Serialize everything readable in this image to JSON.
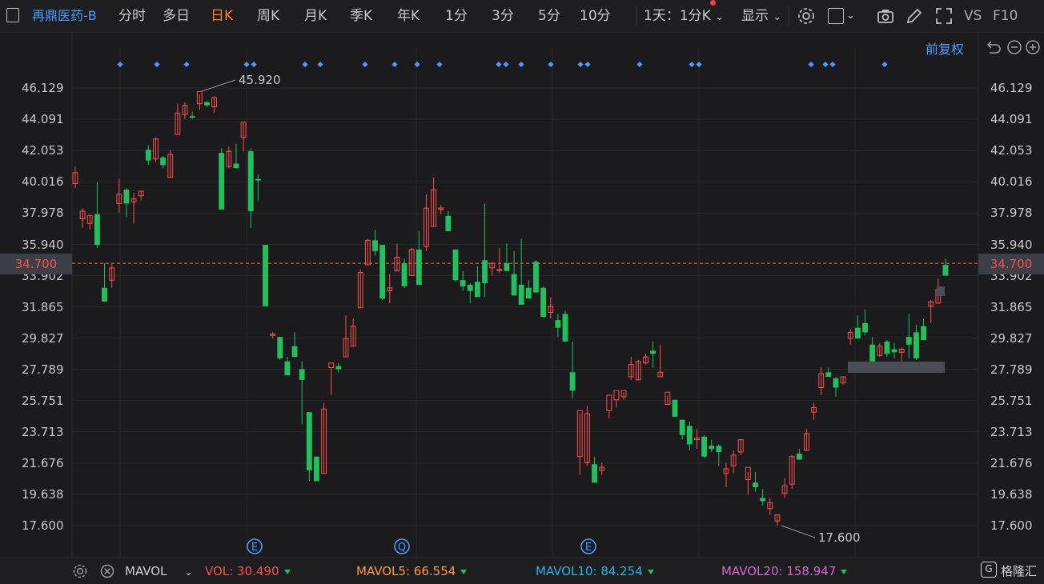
{
  "toolbar": {
    "title": "再鼎医药-B",
    "tabs": [
      "分时",
      "多日",
      "日K",
      "周K",
      "月K",
      "季K",
      "年K",
      "1分",
      "3分",
      "5分",
      "10分"
    ],
    "active_tab": "日K",
    "period_select": "1天：1分K",
    "display": "显示",
    "vs": "VS",
    "f10": "F10"
  },
  "adjust": "前复权",
  "price_axis": [
    "46.129",
    "44.091",
    "42.053",
    "40.016",
    "37.978",
    "35.940",
    "33.902",
    "31.865",
    "29.827",
    "27.789",
    "25.751",
    "23.713",
    "21.676",
    "19.638",
    "17.600"
  ],
  "current_price": "34.700",
  "chart_data": {
    "type": "candlestick",
    "ylim": [
      16.5,
      48.5
    ],
    "high_label": "45.920",
    "low_label": "17.600",
    "event_markers": [
      "E",
      "Q",
      "E"
    ],
    "candles": [
      [
        39.9,
        41.0,
        39.6,
        40.6
      ],
      [
        37.6,
        38.3,
        37.0,
        38.1
      ],
      [
        37.3,
        37.9,
        36.9,
        37.8
      ],
      [
        37.9,
        40.0,
        35.7,
        35.9
      ],
      [
        33.1,
        34.7,
        32.3,
        32.2
      ],
      [
        33.6,
        34.7,
        33.1,
        34.4
      ],
      [
        38.6,
        40.2,
        38.0,
        39.2
      ],
      [
        39.5,
        39.6,
        37.7,
        38.6
      ],
      [
        38.7,
        39.3,
        37.3,
        38.9
      ],
      [
        39.1,
        39.4,
        38.8,
        39.4
      ],
      [
        42.1,
        42.4,
        41.1,
        41.4
      ],
      [
        41.5,
        42.9,
        41.3,
        42.8
      ],
      [
        41.6,
        41.7,
        40.9,
        41.1
      ],
      [
        40.3,
        42.1,
        40.3,
        41.8
      ],
      [
        43.1,
        45.1,
        43.1,
        44.5
      ],
      [
        44.4,
        45.2,
        44.1,
        45.0
      ],
      [
        44.3,
        44.6,
        44.1,
        44.2
      ],
      [
        45.1,
        45.7,
        44.7,
        45.9
      ],
      [
        45.2,
        45.3,
        44.9,
        45.0
      ],
      [
        44.9,
        45.6,
        44.5,
        45.5
      ],
      [
        41.9,
        42.2,
        38.5,
        38.2
      ],
      [
        41.0,
        42.3,
        40.9,
        42.0
      ],
      [
        41.2,
        42.5,
        40.9,
        40.9
      ],
      [
        42.9,
        43.9,
        42.0,
        43.9
      ],
      [
        42.0,
        42.2,
        37.0,
        38.1
      ],
      [
        40.2,
        40.5,
        38.8,
        40.1
      ],
      [
        35.9,
        35.9,
        32.1,
        31.9
      ],
      [
        30.0,
        30.2,
        29.8,
        30.1
      ],
      [
        29.9,
        29.9,
        28.4,
        28.5
      ],
      [
        28.3,
        28.6,
        27.4,
        27.4
      ],
      [
        29.3,
        30.2,
        28.6,
        28.6
      ],
      [
        27.8,
        28.3,
        24.2,
        27.1
      ],
      [
        25.0,
        25.0,
        20.5,
        21.2
      ],
      [
        22.1,
        22.1,
        20.5,
        20.5
      ],
      [
        21.0,
        25.6,
        21.0,
        25.2
      ],
      [
        27.9,
        27.9,
        26.1,
        28.2
      ],
      [
        28.0,
        28.2,
        27.6,
        27.8
      ],
      [
        28.6,
        31.3,
        28.6,
        29.8
      ],
      [
        29.3,
        31.1,
        29.3,
        30.6
      ],
      [
        31.8,
        34.3,
        31.8,
        34.1
      ],
      [
        34.6,
        36.3,
        34.6,
        36.2
      ],
      [
        36.2,
        36.9,
        35.2,
        35.5
      ],
      [
        35.9,
        35.9,
        32.3,
        32.4
      ],
      [
        32.9,
        34.0,
        32.1,
        33.1
      ],
      [
        34.2,
        36.0,
        34.2,
        35.1
      ],
      [
        34.7,
        35.0,
        33.1,
        33.2
      ],
      [
        33.9,
        35.7,
        33.9,
        35.6
      ],
      [
        35.6,
        36.8,
        33.3,
        33.3
      ],
      [
        35.8,
        39.2,
        35.5,
        38.3
      ],
      [
        37.1,
        40.3,
        37.1,
        39.5
      ],
      [
        38.3,
        38.5,
        37.9,
        38.3
      ],
      [
        37.8,
        38.1,
        36.8,
        36.8
      ],
      [
        35.6,
        35.6,
        33.5,
        33.6
      ],
      [
        33.6,
        34.2,
        32.9,
        33.2
      ],
      [
        33.3,
        33.4,
        32.1,
        32.9
      ],
      [
        33.5,
        34.5,
        32.6,
        32.5
      ],
      [
        34.9,
        38.6,
        32.5,
        33.4
      ],
      [
        34.4,
        34.8,
        33.9,
        34.7
      ],
      [
        34.3,
        35.7,
        34.1,
        34.3
      ],
      [
        34.7,
        36.0,
        34.3,
        34.2
      ],
      [
        34.0,
        35.5,
        34.0,
        32.6
      ],
      [
        33.3,
        36.3,
        32.2,
        32.0
      ],
      [
        33.1,
        33.6,
        33.0,
        32.4
      ],
      [
        34.8,
        34.9,
        33.6,
        32.8
      ],
      [
        33.1,
        33.2,
        31.5,
        31.2
      ],
      [
        31.5,
        32.5,
        31.1,
        31.9
      ],
      [
        31.0,
        31.4,
        29.9,
        30.5
      ],
      [
        31.4,
        31.6,
        29.7,
        29.6
      ],
      [
        27.6,
        29.6,
        25.9,
        26.4
      ],
      [
        22.1,
        24.9,
        20.9,
        25.1
      ],
      [
        21.7,
        25.4,
        21.5,
        24.9
      ],
      [
        21.6,
        22.1,
        20.4,
        20.4
      ],
      [
        21.2,
        21.7,
        20.9,
        21.4
      ],
      [
        25.1,
        25.1,
        24.6,
        26.1
      ],
      [
        25.8,
        25.8,
        25.3,
        26.4
      ],
      [
        26.0,
        26.3,
        25.8,
        26.4
      ],
      [
        27.3,
        28.6,
        27.1,
        28.1
      ],
      [
        27.1,
        28.4,
        27.1,
        28.3
      ],
      [
        28.2,
        28.8,
        28.1,
        28.6
      ],
      [
        29.0,
        29.6,
        27.9,
        28.8
      ],
      [
        27.3,
        29.4,
        27.3,
        27.6
      ],
      [
        25.5,
        26.1,
        25.5,
        26.3
      ],
      [
        25.8,
        25.8,
        24.7,
        24.7
      ],
      [
        24.5,
        24.5,
        23.2,
        23.5
      ],
      [
        24.1,
        24.4,
        22.5,
        22.9
      ],
      [
        23.2,
        23.9,
        22.6,
        23.3
      ],
      [
        23.4,
        23.5,
        22.0,
        22.1
      ],
      [
        22.8,
        23.2,
        22.4,
        22.6
      ],
      [
        22.8,
        22.9,
        21.5,
        22.4
      ],
      [
        21.0,
        21.7,
        20.1,
        21.3
      ],
      [
        21.5,
        22.5,
        21.0,
        22.2
      ],
      [
        22.4,
        23.2,
        22.2,
        23.2
      ],
      [
        20.6,
        21.1,
        19.6,
        21.4
      ],
      [
        20.4,
        21.1,
        19.8,
        20.1
      ],
      [
        19.4,
        20.0,
        18.9,
        19.2
      ],
      [
        18.7,
        19.4,
        18.3,
        19.1
      ],
      [
        17.9,
        18.3,
        17.6,
        18.3
      ],
      [
        19.7,
        20.7,
        19.4,
        20.2
      ],
      [
        20.3,
        22.2,
        20.0,
        22.1
      ],
      [
        22.3,
        22.6,
        22.1,
        21.9
      ],
      [
        22.5,
        23.9,
        22.5,
        23.6
      ],
      [
        25.0,
        25.6,
        24.5,
        25.3
      ],
      [
        26.6,
        27.9,
        26.1,
        27.5
      ],
      [
        27.6,
        27.9,
        27.5,
        27.3
      ],
      [
        27.2,
        27.3,
        26.0,
        26.6
      ],
      [
        26.9,
        27.3,
        26.8,
        27.3
      ],
      [
        29.8,
        30.4,
        29.4,
        30.2
      ],
      [
        30.5,
        31.3,
        30.1,
        29.8
      ],
      [
        30.8,
        31.7,
        30.0,
        30.2
      ],
      [
        29.4,
        29.9,
        27.6,
        28.3
      ],
      [
        28.7,
        29.5,
        28.6,
        29.3
      ],
      [
        29.6,
        29.7,
        28.6,
        28.8
      ],
      [
        29.1,
        29.5,
        28.5,
        28.9
      ],
      [
        28.9,
        29.2,
        27.8,
        29.1
      ],
      [
        29.9,
        31.4,
        28.5,
        29.4
      ],
      [
        30.2,
        30.7,
        28.4,
        28.5
      ],
      [
        30.6,
        31.1,
        30.4,
        29.7
      ],
      [
        31.9,
        32.3,
        30.8,
        32.2
      ],
      [
        32.1,
        33.7,
        32.1,
        33.0
      ],
      [
        34.6,
        35.0,
        34.1,
        33.9
      ]
    ]
  },
  "volume_bar": {
    "labels": {
      "indicator": "MAVOL",
      "vol_label": "VOL:",
      "vol_value": "30.490",
      "mavol5_label": "MAVOL5:",
      "mavol5_value": "66.554",
      "mavol10_label": "MAVOL10:",
      "mavol10_value": "84.254",
      "mavol20_label": "MAVOL20:",
      "mavol20_value": "158.947"
    },
    "colors": {
      "vol": "#ff4e4e",
      "mavol5": "#ff9a3c",
      "mavol10": "#25b5e8",
      "mavol20": "#d766d6"
    }
  },
  "logo_text": "格隆汇",
  "colors": {
    "up": "#ff4e4e",
    "down": "#21c05d",
    "accent": "#4a9cff",
    "active": "#ff7a33",
    "bg": "#1b1b1d"
  }
}
